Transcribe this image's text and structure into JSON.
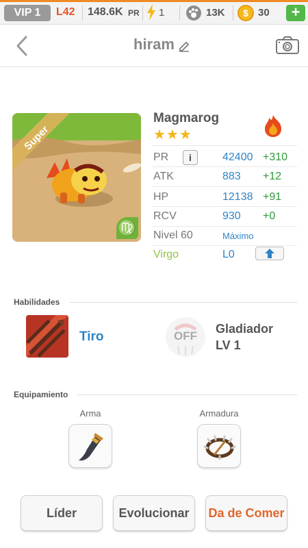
{
  "status_bar": {
    "vip": "VIP 1",
    "level": "L42",
    "power": "148.6K",
    "power_unit": "PR",
    "energy": "1",
    "food": "13K",
    "coins": "30",
    "coin_icon_glyph": "$",
    "add_symbol": "+"
  },
  "header": {
    "title": "hiram"
  },
  "monster": {
    "name": "Magmarog",
    "stars": "★★★",
    "rarity_banner": "Super",
    "zodiac_symbol": "♍",
    "element": "fire",
    "stats": [
      {
        "label": "PR",
        "value": "42400",
        "bonus": "+310"
      },
      {
        "label": "ATK",
        "value": "883",
        "bonus": "+12"
      },
      {
        "label": "HP",
        "value": "12138",
        "bonus": "+91"
      },
      {
        "label": "RCV",
        "value": "930",
        "bonus": "+0"
      }
    ],
    "info_button": "i",
    "level_label": "Nivel 60",
    "level_status": "Máximo",
    "sign_label": "Virgo",
    "sign_level": "L0"
  },
  "skills": {
    "section_title": "Habilidades",
    "active_name": "Tiro",
    "passive_state": "OFF",
    "passive_name": "Gladiador",
    "passive_level": "LV 1"
  },
  "equipment": {
    "section_title": "Equipamiento",
    "weapon_label": "Arma",
    "armor_label": "Armadura"
  },
  "actions": {
    "leader": "Líder",
    "evolve": "Evolucionar",
    "feed": "Da de Comer"
  },
  "colors": {
    "accent_orange": "#e2662a",
    "stat_blue": "#2f84c5",
    "bonus_green": "#2f9a3b",
    "virgo_green": "#8cc63e",
    "star_gold": "#f2b51a"
  }
}
